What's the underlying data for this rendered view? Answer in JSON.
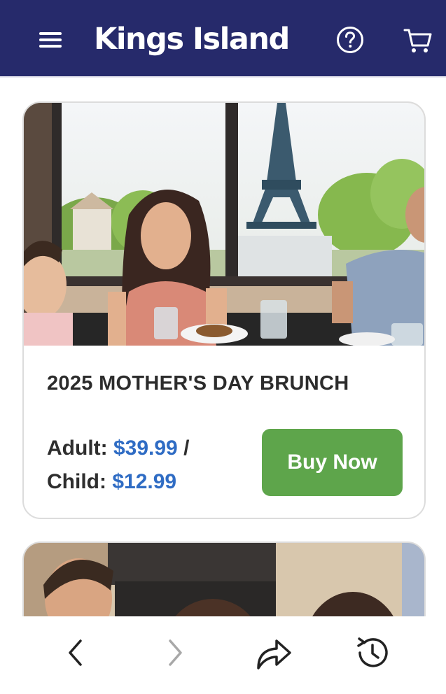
{
  "header": {
    "logo_text": "Kings Island",
    "menu_icon": "hamburger-menu-icon",
    "help_icon": "help-question-icon",
    "cart_icon": "shopping-cart-icon",
    "background_color": "#262a6b"
  },
  "event_card": {
    "title": "2025 MOTHER'S DAY BRUNCH",
    "adult_label": "Adult:",
    "adult_price": "$39.99",
    "separator": "/",
    "child_label": "Child:",
    "child_price": "$12.99",
    "buy_label": "Buy Now",
    "price_color": "#2f6cc4",
    "button_color": "#5ea54b"
  },
  "browser_nav": {
    "back_icon": "chevron-left-icon",
    "forward_icon": "chevron-right-icon",
    "share_icon": "share-arrow-icon",
    "history_icon": "history-clock-icon"
  }
}
